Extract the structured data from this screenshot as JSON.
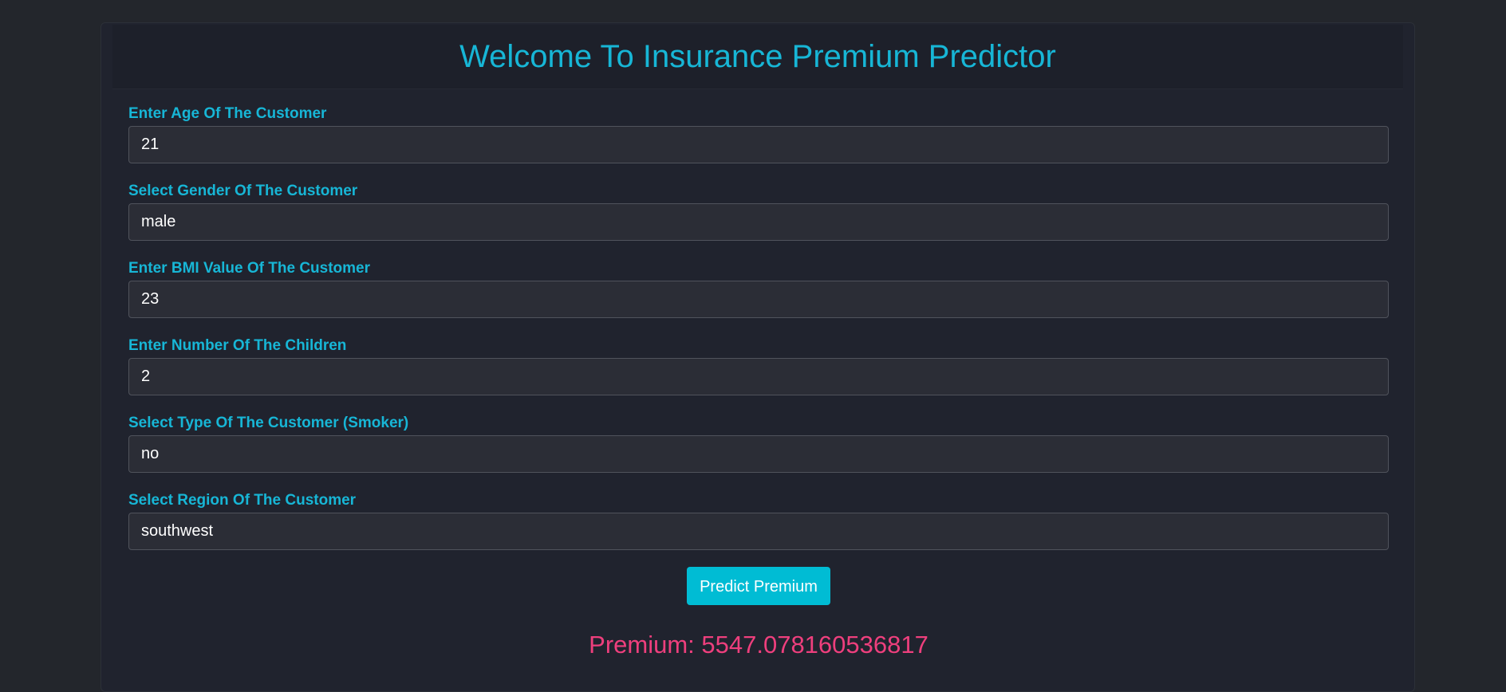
{
  "header": {
    "title": "Welcome To Insurance Premium Predictor"
  },
  "form": {
    "fields": [
      {
        "label": "Enter Age Of The Customer",
        "value": "21"
      },
      {
        "label": "Select Gender Of The Customer",
        "value": "male"
      },
      {
        "label": "Enter BMI Value Of The Customer",
        "value": "23"
      },
      {
        "label": "Enter Number Of The Children",
        "value": "2"
      },
      {
        "label": "Select Type Of The Customer (Smoker)",
        "value": "no"
      },
      {
        "label": "Select Region Of The Customer",
        "value": "southwest"
      }
    ],
    "submit_label": "Predict Premium"
  },
  "result": {
    "text": "Premium: 5547.078160536817"
  },
  "colors": {
    "accent": "#17b6d6",
    "button": "#00bcd4",
    "result": "#ee3f7d",
    "background": "#23262c"
  }
}
